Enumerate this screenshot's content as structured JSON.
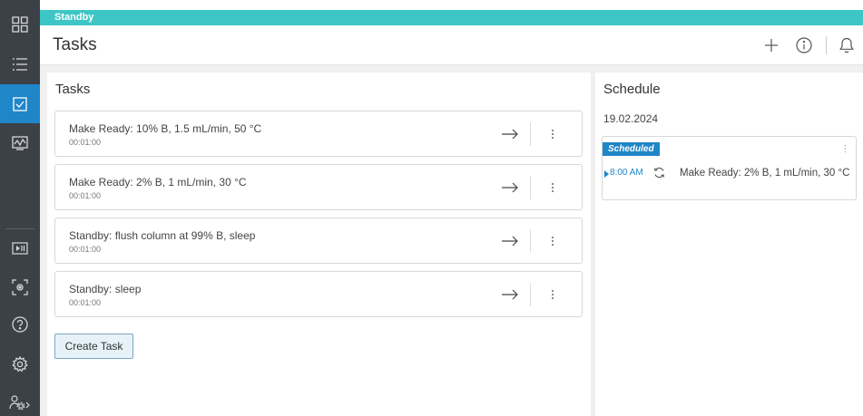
{
  "status": {
    "label": "Standby",
    "color": "#3ec6c6"
  },
  "header": {
    "title": "Tasks",
    "actions": [
      "plus-icon",
      "info-icon",
      "bell-icon"
    ]
  },
  "nav": {
    "items": [
      {
        "icon": "dashboard-grid-icon"
      },
      {
        "icon": "list-icon"
      },
      {
        "icon": "tasks-checkbox-icon",
        "active": true
      },
      {
        "icon": "monitor-chart-icon"
      },
      {
        "icon": "play-pause-icon"
      },
      {
        "icon": "camera-focus-icon"
      },
      {
        "icon": "help-icon"
      },
      {
        "icon": "settings-gear-icon"
      },
      {
        "icon": "user-settings-icon"
      }
    ],
    "accent": "#1f86c8"
  },
  "tasks": {
    "title": "Tasks",
    "items": [
      {
        "name": "Make Ready: 10% B, 1.5 mL/min, 50 °C",
        "duration": "00:01:00"
      },
      {
        "name": "Make Ready: 2% B, 1 mL/min, 30 °C",
        "duration": "00:01:00"
      },
      {
        "name": "Standby: flush column at 99% B, sleep",
        "duration": "00:01:00"
      },
      {
        "name": "Standby: sleep",
        "duration": "00:01:00"
      }
    ],
    "create_label": "Create Task"
  },
  "schedule": {
    "title": "Schedule",
    "date": "19.02.2024",
    "entry": {
      "badge": "Scheduled",
      "time": "8:00 AM",
      "task": "Make Ready: 2% B, 1 mL/min, 30 °C"
    }
  }
}
